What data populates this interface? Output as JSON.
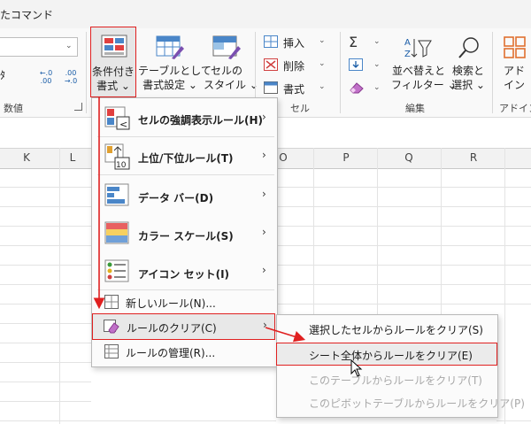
{
  "window": {
    "title_fragment": "たコマンド"
  },
  "ribbon": {
    "number_group_label": "数値",
    "number_format_glyph": "ﾀ",
    "decimal_increase_label": "←.0 .00",
    "decimal_decrease_label": ".00 →.0",
    "buttons": {
      "conditional_formatting": [
        "条件付き",
        "書式 ⌄"
      ],
      "format_as_table": [
        "テーブルとして",
        "書式設定 ⌄"
      ],
      "cell_styles": [
        "セルの",
        "スタイル ⌄"
      ],
      "sort_filter": [
        "並べ替えと",
        "フィルター ⌄"
      ],
      "find_select": [
        "検索と",
        "選択 ⌄"
      ],
      "addins": [
        "アド",
        "イン"
      ]
    },
    "cells_group": {
      "insert": "挿入",
      "delete": "削除",
      "format": "書式",
      "label": "セル"
    },
    "editing_group": {
      "label": "編集"
    },
    "addins_group": {
      "label": "アドイン"
    }
  },
  "sheet": {
    "columns": [
      "K",
      "L",
      "O",
      "P",
      "Q",
      "R"
    ]
  },
  "menu": {
    "items": [
      {
        "label": "セルの強調表示ルール(H)"
      },
      {
        "label": "上位/下位ルール(T)"
      },
      {
        "label": "データ バー(D)"
      },
      {
        "label": "カラー スケール(S)"
      },
      {
        "label": "アイコン セット(I)"
      },
      {
        "label": "新しいルール(N)..."
      },
      {
        "label": "ルールのクリア(C)"
      },
      {
        "label": "ルールの管理(R)..."
      }
    ]
  },
  "submenu": {
    "items": [
      {
        "label": "選択したセルからルールをクリア(S)",
        "enabled": true
      },
      {
        "label": "シート全体からルールをクリア(E)",
        "enabled": true
      },
      {
        "label": "このテーブルからルールをクリア(T)",
        "enabled": false
      },
      {
        "label": "このピボットテーブルからルールをクリア(P)",
        "enabled": false
      }
    ]
  },
  "colors": {
    "highlight_red": "#e02020",
    "menu_hover": "#e8e8e8"
  }
}
